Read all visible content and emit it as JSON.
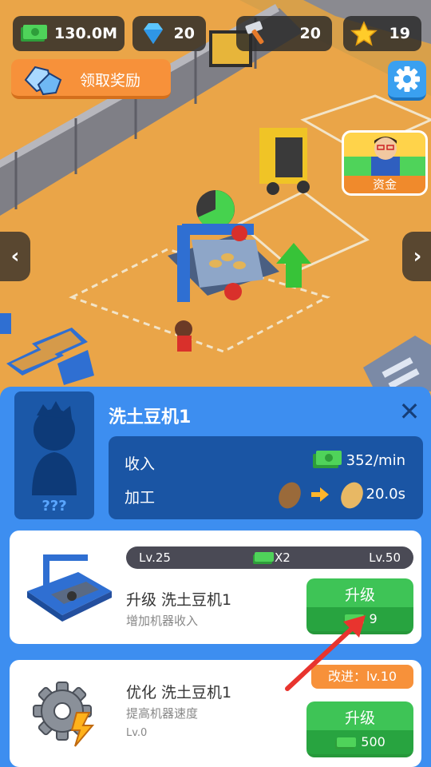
{
  "hud": {
    "cash": "130.0M",
    "gems": "20",
    "tools": "20",
    "stars": "19"
  },
  "reward_button": {
    "label": "领取奖励"
  },
  "funds_button": {
    "label": "资金"
  },
  "nav": {
    "left": "‹",
    "right": "›"
  },
  "panel": {
    "title": "洗土豆机1",
    "portrait_label": "???",
    "close": "✕",
    "stats": {
      "income_label": "收入",
      "income_value": "352/min",
      "process_label": "加工",
      "process_value": "20.0s"
    }
  },
  "upgrade_card": {
    "level_from": "Lv.25",
    "multiplier": "X2",
    "level_to": "Lv.50",
    "title": "升级 洗土豆机1",
    "subtitle": "增加机器收入",
    "button_label": "升级",
    "price": "9"
  },
  "optimize_card": {
    "badge": "改进：lv.10",
    "title": "优化 洗土豆机1",
    "subtitle": "提高机器速度",
    "level": "Lv.0",
    "button_label": "升级",
    "price": "500"
  },
  "colors": {
    "panel_blue": "#3d8ef0",
    "dark_blue": "#1a55a4",
    "button_green": "#3ec456",
    "accent_orange": "#f7913a"
  }
}
